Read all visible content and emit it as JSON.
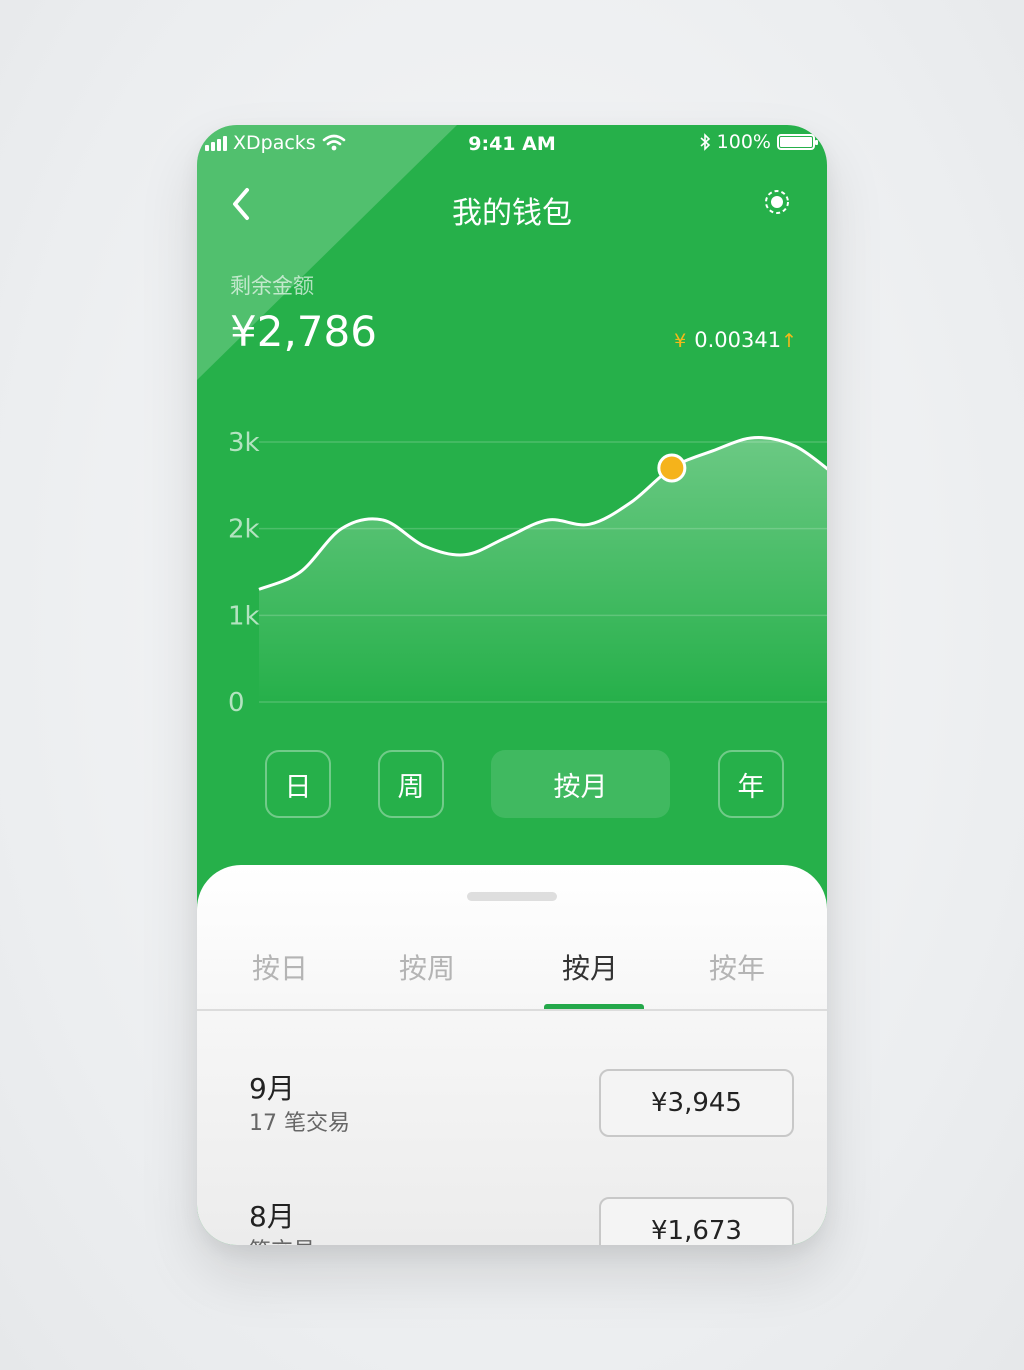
{
  "status_bar": {
    "carrier": "XDpacks",
    "time": "9:41 AM",
    "battery": "100%"
  },
  "nav": {
    "title": "我的钱包"
  },
  "balance": {
    "label": "剩余金额",
    "amount": "¥2,786"
  },
  "change": {
    "currency": "¥",
    "value": "0.00341",
    "arrow": "↑"
  },
  "chart_data": {
    "type": "area",
    "y_ticks": [
      "3k",
      "2k",
      "1k",
      "0"
    ],
    "ylim": [
      0,
      3000
    ],
    "points_y": [
      1300,
      1500,
      2000,
      2100,
      1800,
      1700,
      1900,
      2100,
      2050,
      2300,
      2700,
      2900,
      3050,
      2950,
      2600
    ],
    "highlight_index": 10,
    "colors": {
      "line": "#ffffff",
      "highlight": "#f5b31b"
    }
  },
  "period_buttons": [
    "日",
    "周",
    "按月",
    "年"
  ],
  "sheet": {
    "tabs": [
      "按日",
      "按周",
      "按月",
      "按年"
    ],
    "active_tab": 2,
    "rows": [
      {
        "month": "9月",
        "count": "17 笔交易",
        "amount": "¥3,945"
      },
      {
        "month": "8月",
        "count": "笔交易",
        "amount": "¥1,673"
      }
    ]
  },
  "colors": {
    "brand": "#26b04a",
    "accent": "#f5b31b",
    "tab_active": "#24a84a"
  }
}
